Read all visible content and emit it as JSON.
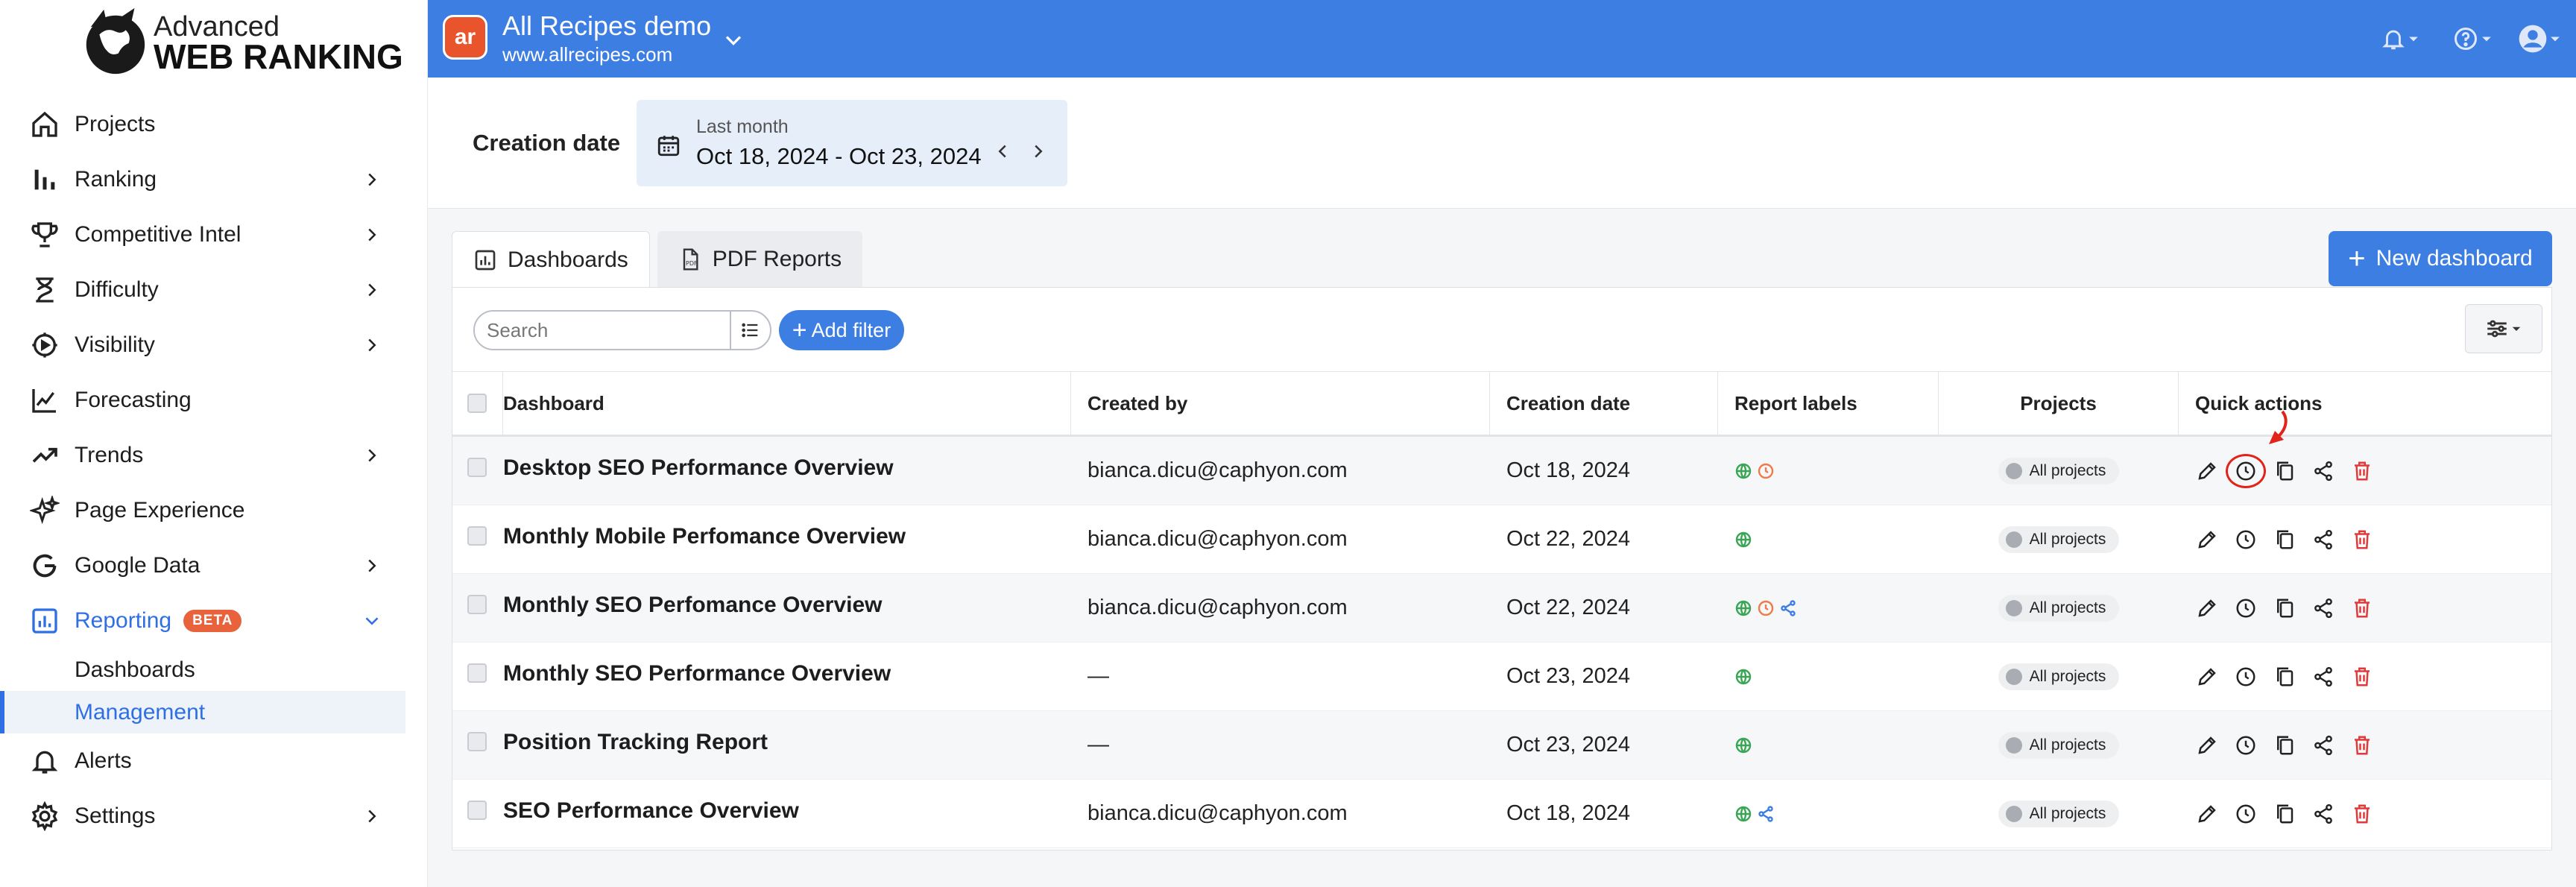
{
  "logo": {
    "line1": "Advanced",
    "line2": "WEB RANKING"
  },
  "sidebar": {
    "items": [
      {
        "label": "Projects",
        "icon": "home-icon",
        "chevron": false
      },
      {
        "label": "Ranking",
        "icon": "bar-chart-icon",
        "chevron": true
      },
      {
        "label": "Competitive Intel",
        "icon": "trophy-icon",
        "chevron": true
      },
      {
        "label": "Difficulty",
        "icon": "hourglass-icon",
        "chevron": true
      },
      {
        "label": "Visibility",
        "icon": "visibility-gear-icon",
        "chevron": true
      },
      {
        "label": "Forecasting",
        "icon": "forecast-chart-icon",
        "chevron": false
      },
      {
        "label": "Trends",
        "icon": "trend-up-icon",
        "chevron": true
      },
      {
        "label": "Page Experience",
        "icon": "sparkle-icon",
        "chevron": false
      },
      {
        "label": "Google Data",
        "icon": "google-icon",
        "chevron": true
      },
      {
        "label": "Reporting",
        "icon": "report-chart-icon",
        "chevron": true,
        "badge": "BETA",
        "active": true
      }
    ],
    "reporting_sub": [
      {
        "label": "Dashboards"
      },
      {
        "label": "Management",
        "selected": true
      }
    ],
    "bottom_items": [
      {
        "label": "Alerts",
        "icon": "bell-icon",
        "chevron": false
      },
      {
        "label": "Settings",
        "icon": "gear-icon",
        "chevron": true
      }
    ]
  },
  "topbar": {
    "avatar_text": "ar",
    "project_name": "All Recipes demo",
    "project_url": "www.allrecipes.com",
    "bg_color": "#3d7ee3"
  },
  "filters": {
    "creation_label": "Creation date",
    "date_preset": "Last month",
    "date_range": "Oct 18, 2024 - Oct 23, 2024"
  },
  "tabs": [
    {
      "label": "Dashboards",
      "icon": "dashboard-icon",
      "active": true
    },
    {
      "label": "PDF Reports",
      "icon": "pdf-icon",
      "active": false
    }
  ],
  "new_dashboard_label": "New dashboard",
  "search": {
    "placeholder": "Search"
  },
  "add_filter_label": "Add filter",
  "table": {
    "columns": [
      "Dashboard",
      "Created by",
      "Creation date",
      "Report labels",
      "Projects",
      "Quick actions"
    ],
    "rows": [
      {
        "name": "Desktop SEO Performance Overview",
        "created_by": "bianca.dicu@caphyon.com",
        "date": "Oct 18, 2024",
        "labels": [
          "globe",
          "clock"
        ],
        "projects": "All projects",
        "highlight_schedule": true
      },
      {
        "name": "Monthly Mobile Perfomance Overview",
        "created_by": "bianca.dicu@caphyon.com",
        "date": "Oct 22, 2024",
        "labels": [
          "globe"
        ],
        "projects": "All projects"
      },
      {
        "name": "Monthly SEO Perfomance Overview",
        "created_by": "bianca.dicu@caphyon.com",
        "date": "Oct 22, 2024",
        "labels": [
          "globe",
          "clock",
          "share"
        ],
        "projects": "All projects"
      },
      {
        "name": "Monthly SEO Performance Overview",
        "created_by": "—",
        "date": "Oct 23, 2024",
        "labels": [
          "globe"
        ],
        "projects": "All projects"
      },
      {
        "name": "Position Tracking Report",
        "created_by": "—",
        "date": "Oct 23, 2024",
        "labels": [
          "globe"
        ],
        "projects": "All projects"
      },
      {
        "name": "SEO Performance Overview",
        "created_by": "bianca.dicu@caphyon.com",
        "date": "Oct 18, 2024",
        "labels": [
          "globe",
          "share"
        ],
        "projects": "All projects"
      }
    ]
  },
  "colors": {
    "accent": "#3d7ee3",
    "active_nav": "#2f6fe4",
    "beta": "#e8623b",
    "globe_label": "#3aa655",
    "clock_label": "#ef7b4a",
    "share_label": "#3d7ee3",
    "delete": "#e03a3a",
    "annotation": "#e0241a"
  }
}
